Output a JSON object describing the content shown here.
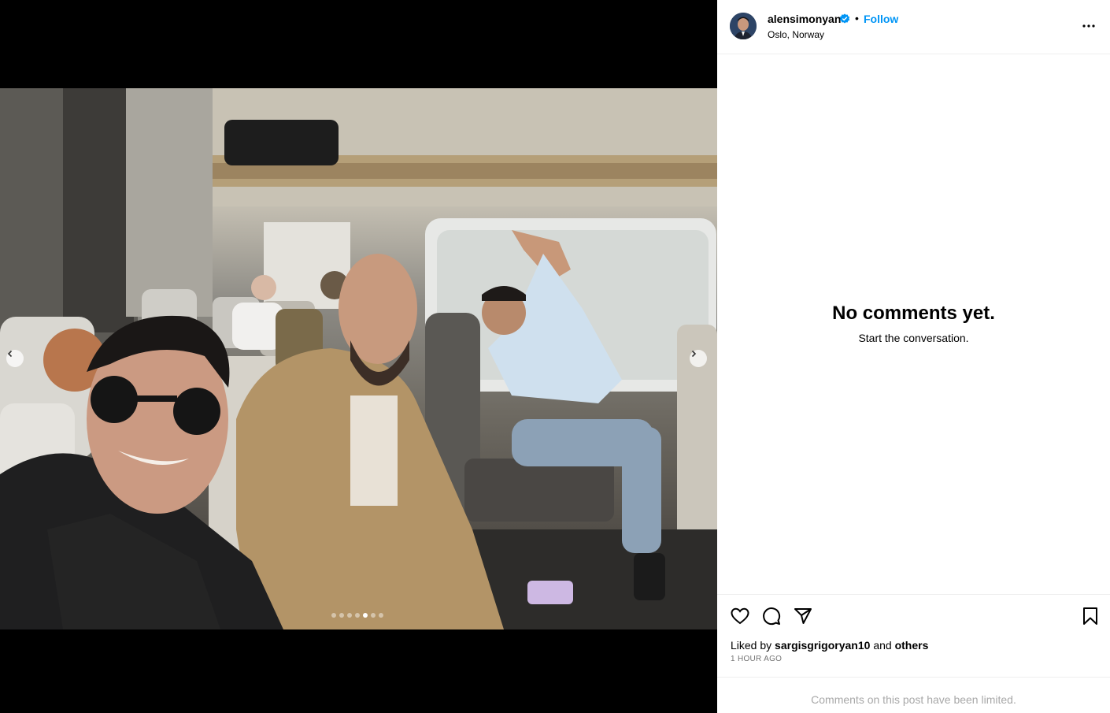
{
  "post": {
    "username": "alensimonyan",
    "separator": "•",
    "follow_label": "Follow",
    "location": "Oslo, Norway",
    "avatar_icon": "avatar-image",
    "verified_icon": "verified-badge-icon",
    "more_icon": "more-options-icon"
  },
  "media": {
    "image_description_icon": "train-selfie-photo",
    "carousel": {
      "total": 7,
      "active_index": 4
    },
    "prev_icon": "chevron-left-icon",
    "next_icon": "chevron-right-icon"
  },
  "comments": {
    "empty_title": "No comments yet.",
    "empty_subtitle": "Start the conversation."
  },
  "actions": {
    "like_icon": "heart-icon",
    "comment_icon": "comment-icon",
    "share_icon": "send-icon",
    "save_icon": "bookmark-icon"
  },
  "likes": {
    "prefix": "Liked by",
    "user": "sargisgrigoryan10",
    "conjunction": "and",
    "others": "others"
  },
  "timestamp": "1 HOUR AGO",
  "footer_note": "Comments on this post have been limited.",
  "colors": {
    "accent": "#0095f6",
    "muted": "#737373",
    "limited": "#a8a8a8"
  }
}
